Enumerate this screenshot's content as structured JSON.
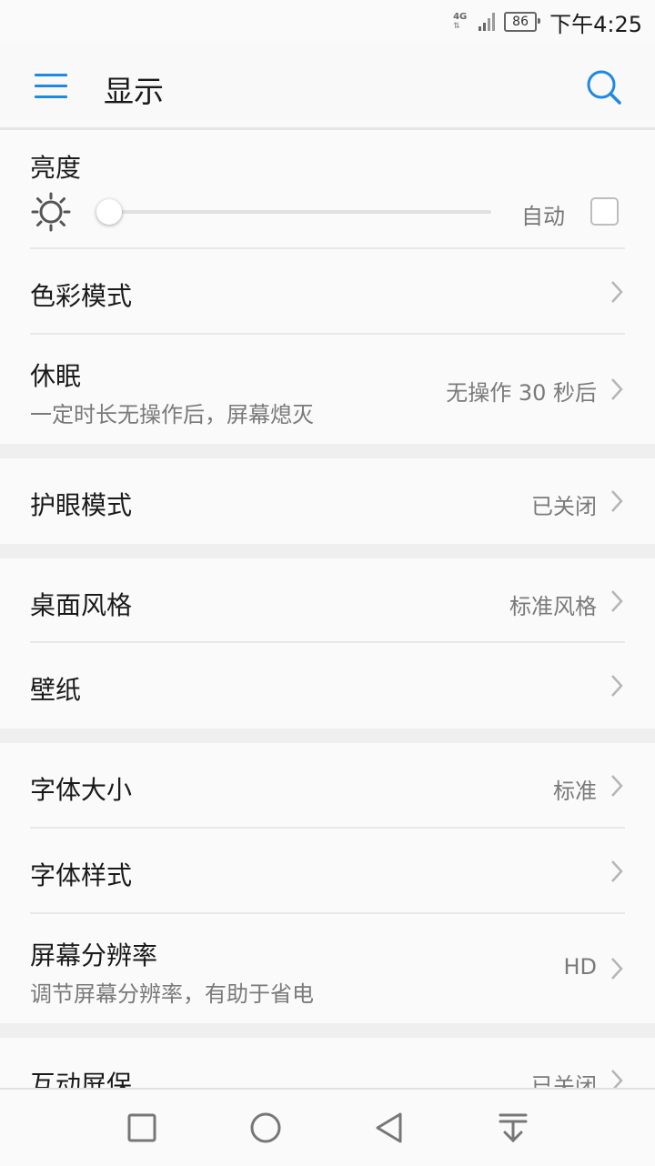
{
  "status_bar": {
    "network": "4G",
    "battery": "86",
    "time": "下午4:25"
  },
  "toolbar": {
    "title": "显示",
    "menu_icon": "menu-icon",
    "search_icon": "search-icon"
  },
  "brightness": {
    "title": "亮度",
    "auto_label": "自动",
    "auto_checked": false,
    "level": 0.0
  },
  "items": [
    {
      "label": "色彩模式",
      "sub": "",
      "value": ""
    },
    {
      "label": "休眠",
      "sub": "一定时长无操作后，屏幕熄灭",
      "value": "无操作 30 秒后"
    },
    {
      "label": "护眼模式",
      "sub": "",
      "value": "已关闭"
    },
    {
      "label": "桌面风格",
      "sub": "",
      "value": "标准风格"
    },
    {
      "label": "壁纸",
      "sub": "",
      "value": ""
    },
    {
      "label": "字体大小",
      "sub": "",
      "value": "标准"
    },
    {
      "label": "字体样式",
      "sub": "",
      "value": ""
    },
    {
      "label": "屏幕分辨率",
      "sub": "调节屏幕分辨率，有助于省电",
      "value": "HD"
    },
    {
      "label": "互动屏保",
      "sub": "",
      "value": "已关闭"
    }
  ],
  "nav_bar": {
    "buttons": [
      "recents-icon",
      "home-icon",
      "back-icon",
      "notification-pull-icon"
    ]
  }
}
